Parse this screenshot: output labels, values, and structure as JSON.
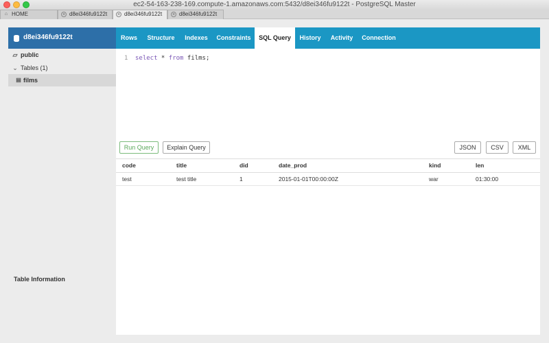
{
  "window": {
    "title": "ec2-54-163-238-169.compute-1.amazonaws.com:5432/d8ei346fu9122t - PostgreSQL Master"
  },
  "browser_tabs": [
    {
      "label": "HOME",
      "icon": "home-icon",
      "active": false
    },
    {
      "label": "d8ei346fu9122t",
      "icon": "close-icon",
      "active": false
    },
    {
      "label": "d8ei346fu9122t",
      "icon": "close-icon",
      "active": true
    },
    {
      "label": "d8ei346fu9122t",
      "icon": "close-icon",
      "active": false
    }
  ],
  "sidebar": {
    "database": "d8ei346fu9122t",
    "schema": "public",
    "tables_label": "Tables (1)",
    "tables": [
      "films"
    ],
    "footer_label": "Table Information"
  },
  "nav": {
    "tabs": [
      "Rows",
      "Structure",
      "Indexes",
      "Constraints",
      "SQL Query",
      "History",
      "Activity",
      "Connection"
    ],
    "active": "SQL Query"
  },
  "editor": {
    "line_number": "1",
    "keyword_select": "select",
    "star": " * ",
    "keyword_from": "from",
    "table": " films;"
  },
  "buttons": {
    "run": "Run Query",
    "explain": "Explain Query",
    "json": "JSON",
    "csv": "CSV",
    "xml": "XML"
  },
  "results": {
    "columns": [
      "code",
      "title",
      "did",
      "date_prod",
      "kind",
      "len"
    ],
    "rows": [
      [
        "test",
        "test title",
        "1",
        "2015-01-01T00:00:00Z",
        "war",
        "01:30:00"
      ]
    ]
  },
  "colors": {
    "sidebar_header": "#2d6fa8",
    "nav_bar": "#1b97c4",
    "run_button_text": "#5aa85a",
    "keyword": "#7a56b5"
  }
}
